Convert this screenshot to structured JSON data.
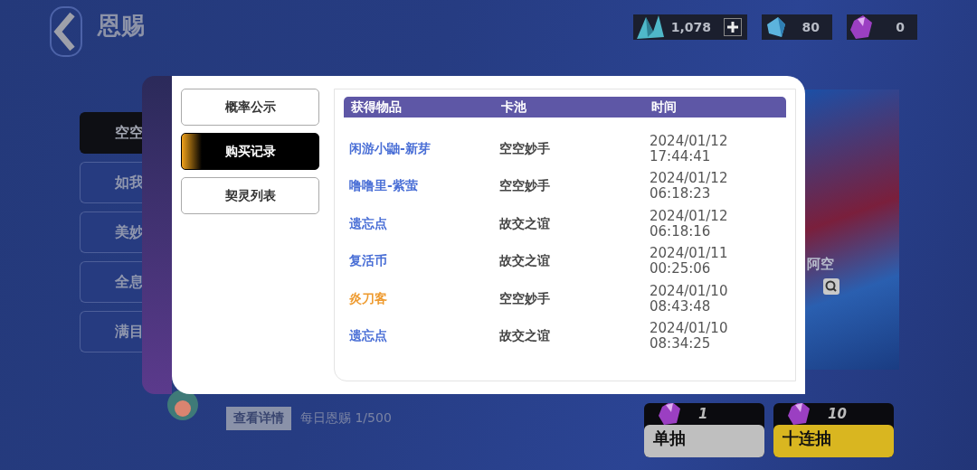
{
  "header": {
    "title": "恩赐"
  },
  "currencies": [
    {
      "kind": "crystal",
      "amount": "1,078",
      "addable": true
    },
    {
      "kind": "shard",
      "amount": "80",
      "addable": false
    },
    {
      "kind": "gem",
      "amount": "0",
      "addable": false
    }
  ],
  "pools": [
    {
      "label": "空空",
      "selected": true
    },
    {
      "label": "如我",
      "selected": false
    },
    {
      "label": "美妙",
      "selected": false
    },
    {
      "label": "全息",
      "selected": false
    },
    {
      "label": "满目",
      "selected": false
    }
  ],
  "banner": {
    "name": "阿空"
  },
  "dialog": {
    "tabs": [
      {
        "label": "概率公示",
        "selected": false
      },
      {
        "label": "购买记录",
        "selected": true
      },
      {
        "label": "契灵列表",
        "selected": false
      }
    ],
    "table": {
      "columns": [
        "获得物品",
        "卡池",
        "时间"
      ],
      "rows": [
        {
          "item": "闲游小鼬-新芽",
          "color": "#4a6fd6",
          "pool": "空空妙手",
          "date": "2024/01/12",
          "time": "17:44:41"
        },
        {
          "item": "噜噜里-紫萤",
          "color": "#4a6fd6",
          "pool": "空空妙手",
          "date": "2024/01/12",
          "time": "06:18:23"
        },
        {
          "item": "遗忘点",
          "color": "#4a6fd6",
          "pool": "故交之谊",
          "date": "2024/01/12",
          "time": "06:18:16"
        },
        {
          "item": "复活币",
          "color": "#4a6fd6",
          "pool": "故交之谊",
          "date": "2024/01/11",
          "time": "00:25:06"
        },
        {
          "item": "炎刀客",
          "color": "#ee9a2e",
          "pool": "空空妙手",
          "date": "2024/01/10",
          "time": "08:43:48"
        },
        {
          "item": "遗忘点",
          "color": "#4a6fd6",
          "pool": "故交之谊",
          "date": "2024/01/10",
          "time": "08:34:25"
        }
      ]
    }
  },
  "footer": {
    "details_button": "查看详情",
    "daily_label": "每日恩赐 1/500"
  },
  "draws": [
    {
      "kind": "single",
      "cost": "1",
      "label": "单抽"
    },
    {
      "kind": "ten",
      "cost": "10",
      "label": "十连抽"
    }
  ]
}
